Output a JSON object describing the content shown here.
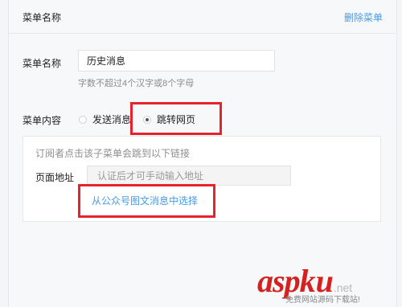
{
  "header": {
    "title": "菜单名称",
    "delete_label": "删除菜单"
  },
  "menu_name": {
    "label": "菜单名称",
    "value": "历史消息",
    "hint": "字数不超过4个汉字或8个字母"
  },
  "menu_content": {
    "label": "菜单内容",
    "options": [
      {
        "label": "发送消息",
        "selected": false
      },
      {
        "label": "跳转网页",
        "selected": true
      }
    ]
  },
  "jump_page": {
    "description": "订阅者点击该子菜单会跳到以下链接",
    "url_label": "页面地址",
    "url_placeholder": "认证后才可手动输入地址",
    "choose_link": "从公众号图文消息中选择"
  },
  "highlight_color": "#e8222c",
  "link_color": "#459ae9",
  "watermark": {
    "asp": "asp",
    "ku": "ku",
    "net": ".net",
    "tagline": "免费网站源码下载站!"
  }
}
